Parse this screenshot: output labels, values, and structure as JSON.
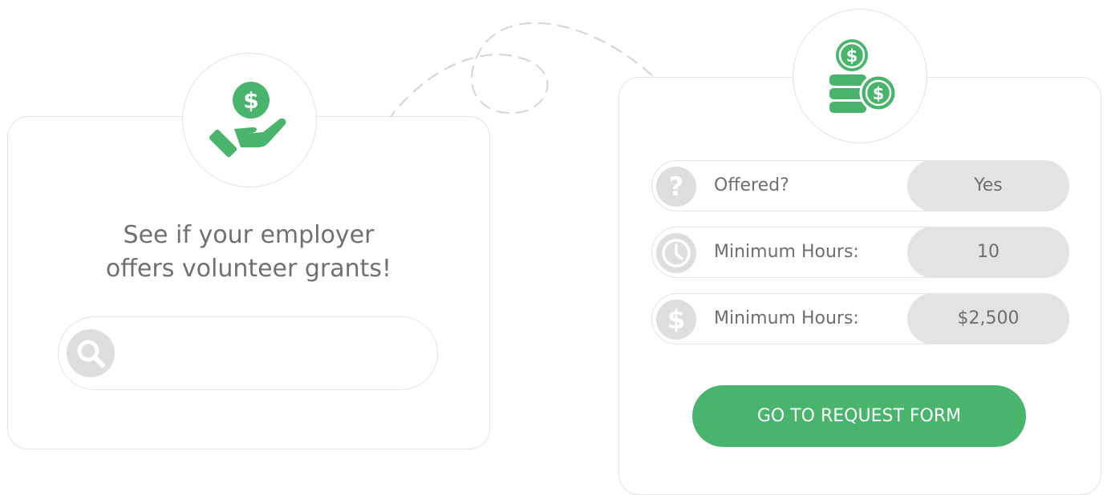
{
  "colors": {
    "accent": "#48b46c",
    "muted_icon": "#dedede",
    "pill": "#e3e3e3",
    "text": "#707070"
  },
  "left_card": {
    "badge_icon": "hand-holding-dollar-icon",
    "headline_line1": "See if your employer",
    "headline_line2": "offers volunteer grants!",
    "search": {
      "icon": "search-icon",
      "value": "",
      "placeholder": ""
    }
  },
  "right_card": {
    "badge_icon": "coin-stack-icon",
    "rows": [
      {
        "icon": "question-icon",
        "label": "Offered?",
        "value": "Yes"
      },
      {
        "icon": "clock-icon",
        "label": "Minimum Hours:",
        "value": "10"
      },
      {
        "icon": "dollar-icon",
        "label": "Minimum Hours:",
        "value": "$2,500"
      }
    ],
    "cta_label": "GO TO REQUEST FORM"
  },
  "connector": "dashed-arrow"
}
